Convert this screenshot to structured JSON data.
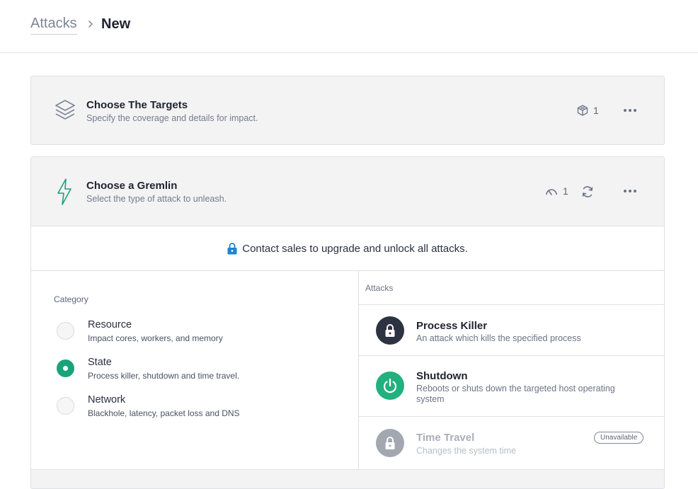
{
  "breadcrumb": {
    "parent": "Attacks",
    "current": "New"
  },
  "targets_card": {
    "title": "Choose The Targets",
    "subtitle": "Specify the coverage and details for impact.",
    "count": "1"
  },
  "gremlin_card": {
    "title": "Choose a Gremlin",
    "subtitle": "Select the type of attack to unleash.",
    "count": "1",
    "notice": "Contact sales to upgrade and unlock all attacks.",
    "category_heading": "Category",
    "categories": [
      {
        "label": "Resource",
        "desc": "Impact cores, workers, and memory",
        "checked": false
      },
      {
        "label": "State",
        "desc": "Process killer, shutdown and time travel.",
        "checked": true
      },
      {
        "label": "Network",
        "desc": "Blackhole, latency, packet loss and DNS",
        "checked": false
      }
    ],
    "attacks_heading": "Attacks",
    "attacks": [
      {
        "title": "Process Killer",
        "desc": "An attack which kills the specified process",
        "icon": "lock-icon"
      },
      {
        "title": "Shutdown",
        "desc": "Reboots or shuts down the targeted host operating system",
        "icon": "power-icon"
      },
      {
        "title": "Time Travel",
        "desc": "Changes the system time",
        "icon": "lock-icon",
        "badge": "Unavailable"
      }
    ]
  },
  "colors": {
    "accent": "#1aa37a",
    "dark_icon": "#2e3342",
    "disabled_icon": "#a3a7b0",
    "lock_blue": "#1b84d4"
  }
}
